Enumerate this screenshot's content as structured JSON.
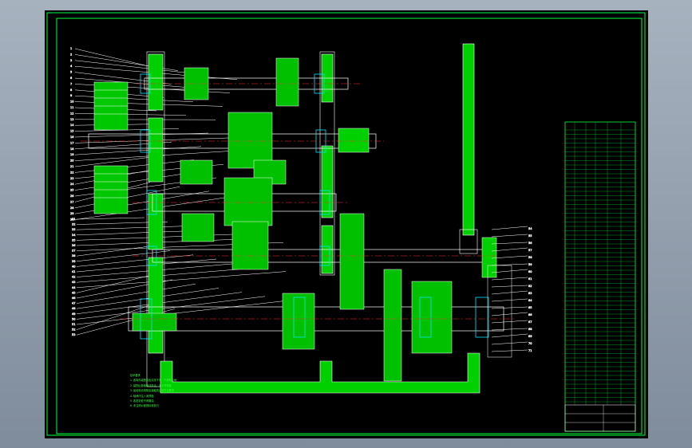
{
  "drawing": {
    "background": "#000000",
    "frame_color": "#00ff3c",
    "outline_color": "#ffffff",
    "section_color": "#00e000",
    "centerline_color": "#ff3030",
    "bearing_color": "#00e5ff",
    "leader_color": "#ffffff"
  },
  "notes": {
    "heading": "技术要求",
    "lines": [
      "1. 各零件装配前应清洗干净，不得有毛刺",
      "2. 装配后各轴转动灵活，无卡滞现象",
      "3. 齿轮啮合侧隙及接触斑点应符合要求",
      "4. 轴承内注入润滑脂",
      "5. 各密封处不得漏油",
      "6. 未注明公差按标准执行"
    ]
  },
  "balloons": {
    "left_top": [
      "1",
      "2",
      "3",
      "4",
      "5",
      "6",
      "7",
      "8",
      "9",
      "10",
      "11",
      "12",
      "13",
      "14",
      "15",
      "16",
      "17",
      "18",
      "19",
      "20",
      "21",
      "22",
      "23",
      "24",
      "25",
      "26",
      "27",
      "28",
      "29",
      "30"
    ],
    "left_mid": [
      "31",
      "32",
      "33",
      "34",
      "35",
      "36",
      "37",
      "38",
      "39",
      "40",
      "41",
      "42",
      "43",
      "44",
      "45",
      "46",
      "47",
      "48",
      "49",
      "50",
      "51",
      "52",
      "53"
    ],
    "right": [
      "54",
      "55",
      "56",
      "57",
      "58",
      "59",
      "60",
      "61",
      "62",
      "63",
      "64",
      "65",
      "66",
      "67",
      "68",
      "69",
      "70",
      "71"
    ]
  }
}
